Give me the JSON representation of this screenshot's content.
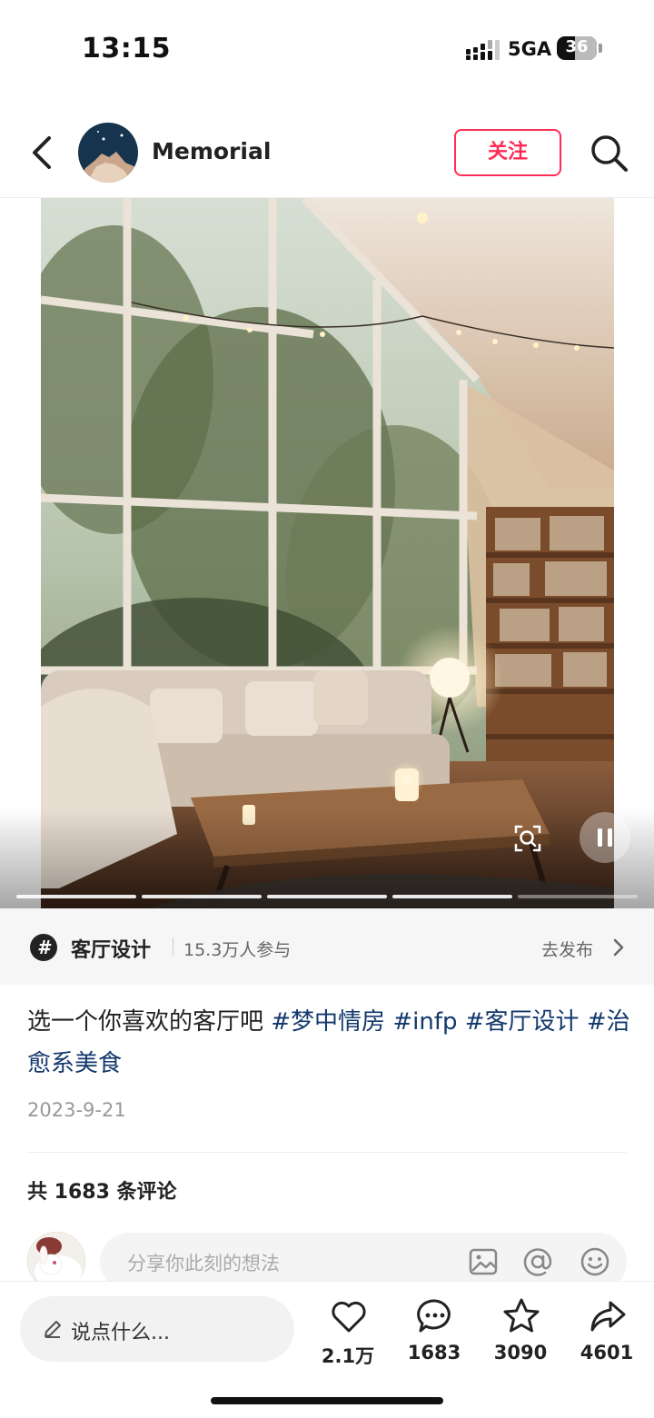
{
  "status_bar": {
    "time": "13:15",
    "network": "5GA",
    "battery": "36"
  },
  "header": {
    "username": "Memorial",
    "follow_label": "关注"
  },
  "media": {
    "total_slides": 5,
    "current_slide": 4
  },
  "topic": {
    "name": "客厅设计",
    "participants": "15.3万人参与",
    "post_label": "去发布"
  },
  "post": {
    "caption_text": "选一个你喜欢的客厅吧 ",
    "hashtags": [
      "#梦中情房",
      "#infp",
      "#客厅设计",
      "#治愈系美食"
    ],
    "date": "2023-9-21"
  },
  "comments": {
    "count_label": "共 1683 条评论",
    "input_placeholder": "分享你此刻的想法"
  },
  "bottom_bar": {
    "say_placeholder": "说点什么...",
    "likes": "2.1万",
    "comments": "1683",
    "favorites": "3090",
    "shares": "4601"
  },
  "colors": {
    "accent": "#ff2d55",
    "hashtag": "#13386c"
  }
}
